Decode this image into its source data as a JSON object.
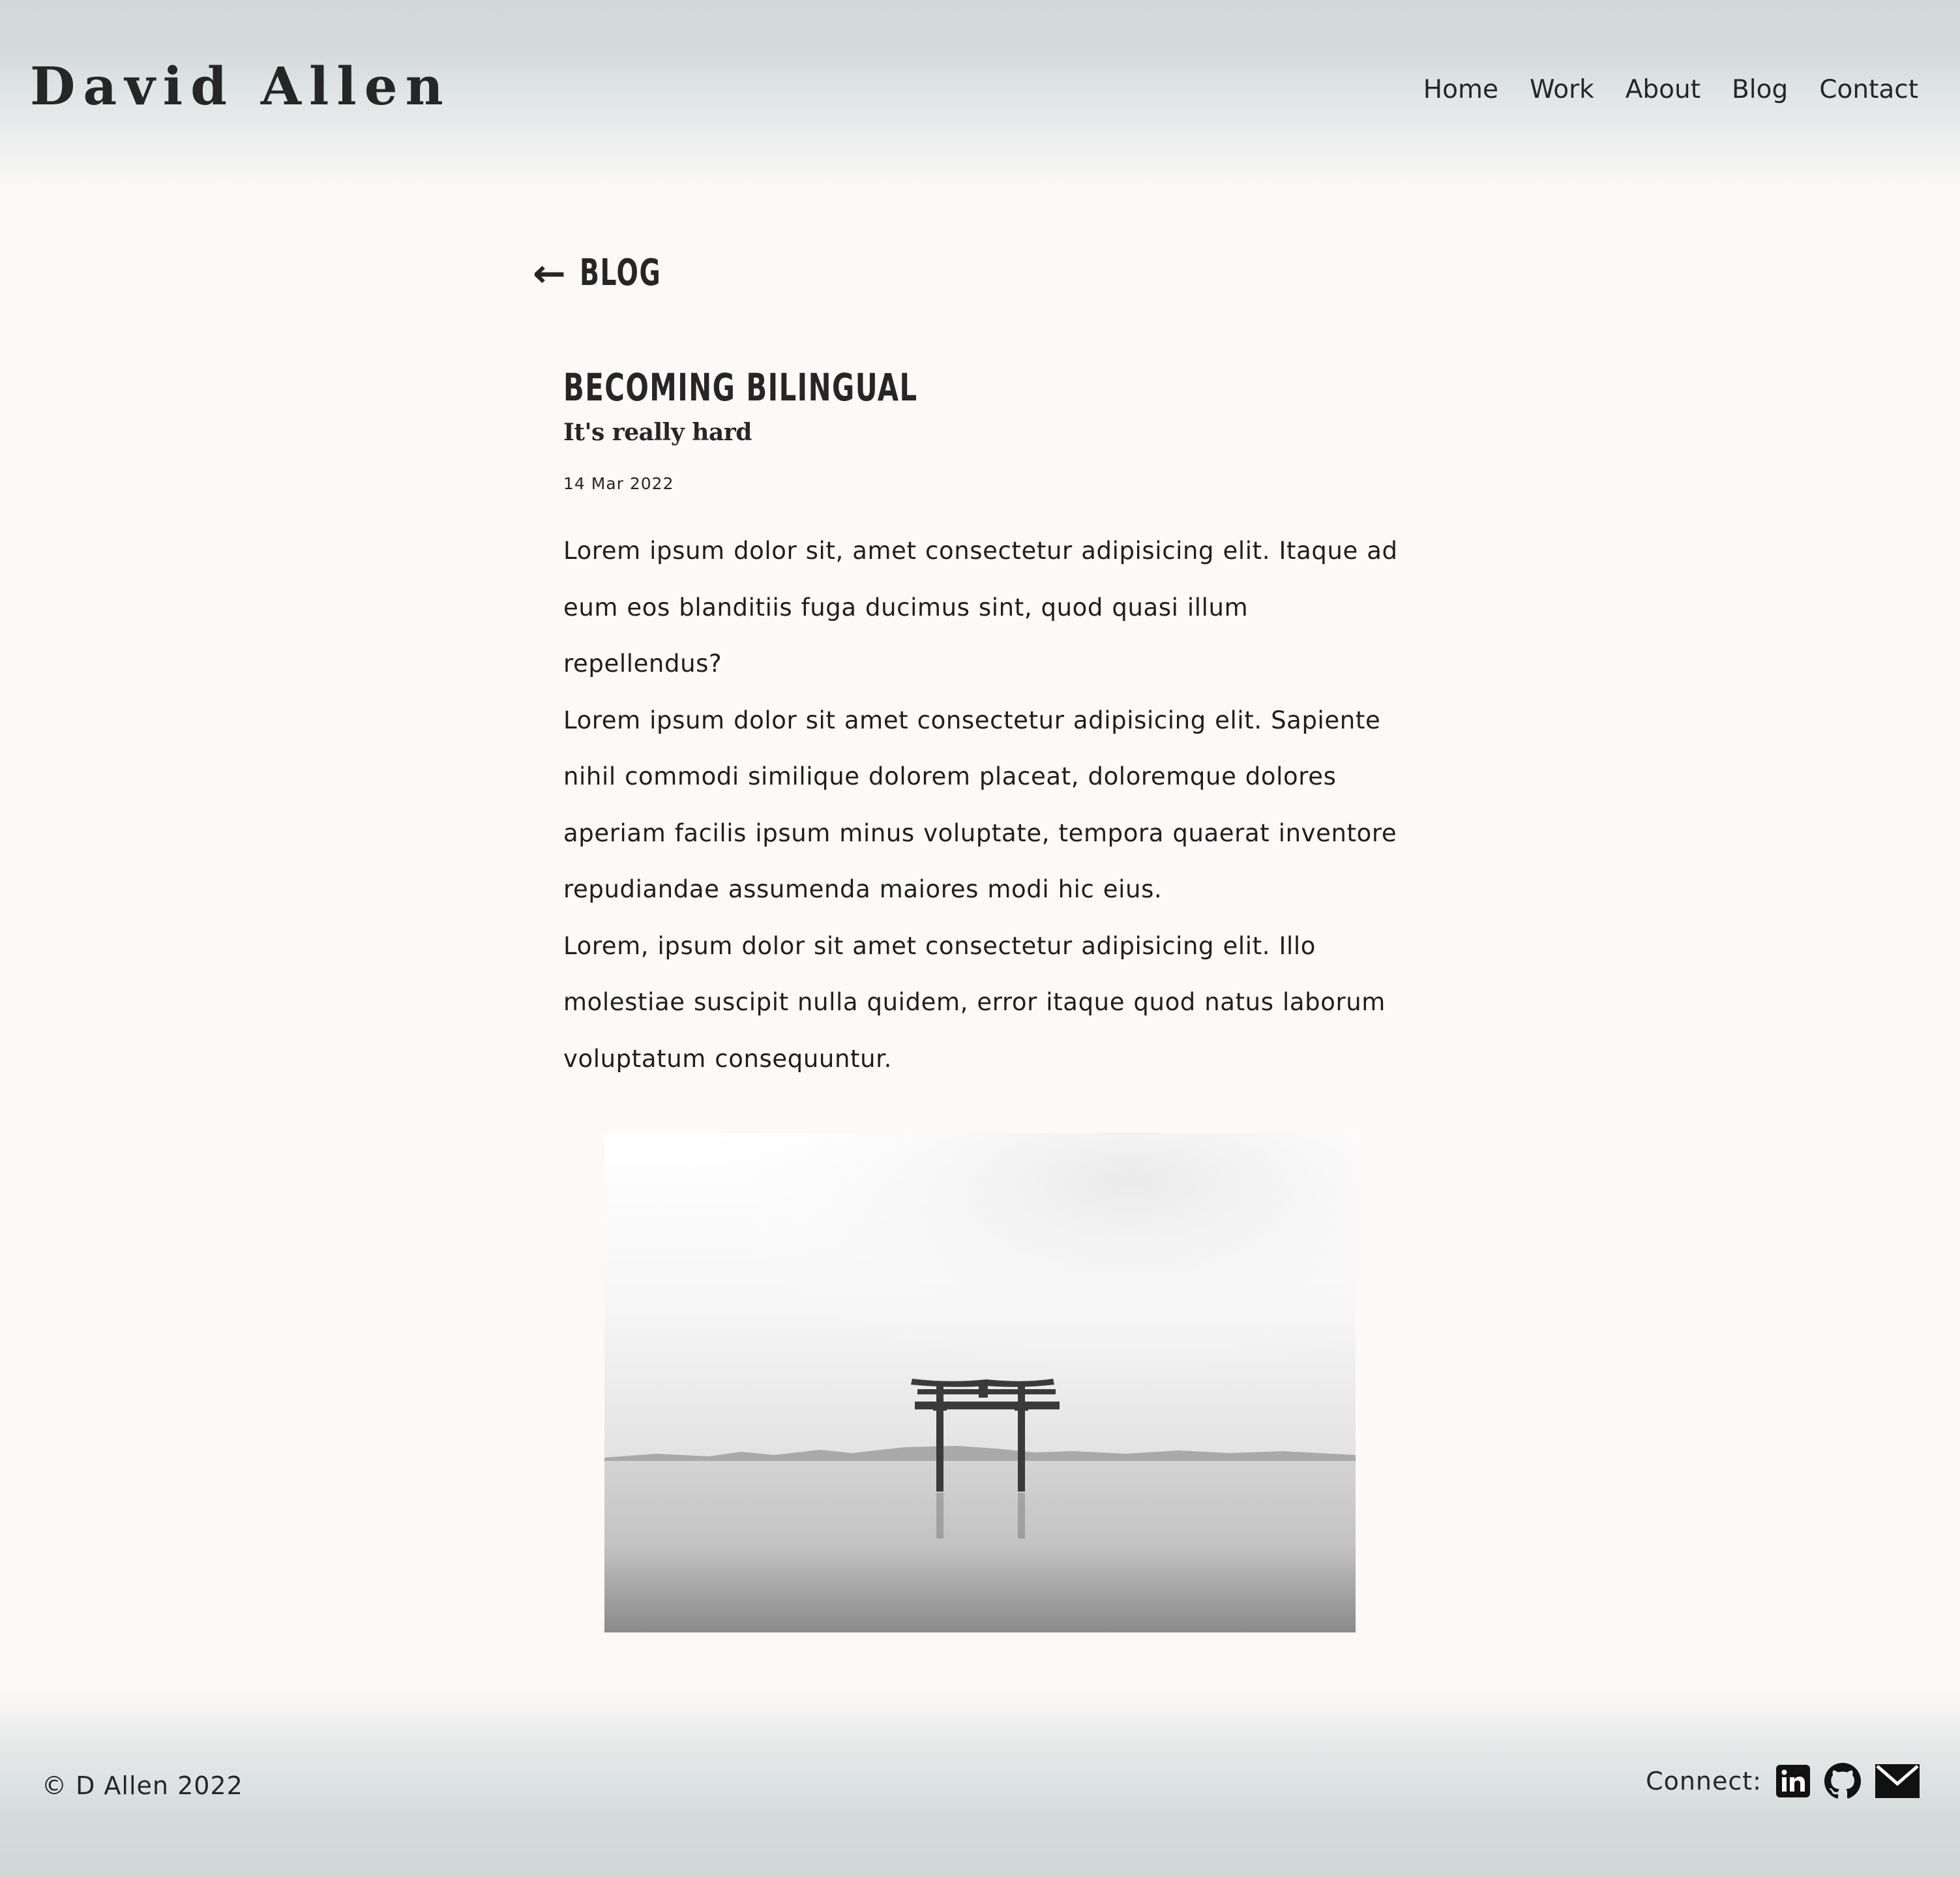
{
  "header": {
    "logo": "David Allen",
    "nav": [
      "Home",
      "Work",
      "About",
      "Blog",
      "Contact"
    ]
  },
  "back_link": {
    "arrow": "←",
    "label": "BLOG"
  },
  "post": {
    "title": "BECOMING BILINGUAL",
    "subtitle": "It's really hard",
    "date": "14 Mar 2022",
    "paragraphs": [
      "Lorem ipsum dolor sit, amet consectetur adipisicing elit. Itaque ad eum eos blanditiis fuga ducimus sint, quod quasi illum repellendus?",
      "Lorem ipsum dolor sit amet consectetur adipisicing elit. Sapiente nihil commodi similique dolorem placeat, doloremque dolores aperiam facilis ipsum minus voluptate, tempora quaerat inventore repudiandae assumenda maiores modi hic eius.",
      "Lorem, ipsum dolor sit amet consectetur adipisicing elit. Illo molestiae suscipit nulla quidem, error itaque quod natus laborum voluptatum consequuntur."
    ],
    "image_icon": "torii-gate-photo"
  },
  "footer": {
    "copyright": "© D Allen 2022",
    "connect_label": "Connect:",
    "social": [
      "linkedin-icon",
      "github-icon",
      "mail-icon"
    ]
  },
  "colors": {
    "text": "#262626",
    "background": "#fcf9f8",
    "header_gradient": "#d1d8d8"
  }
}
